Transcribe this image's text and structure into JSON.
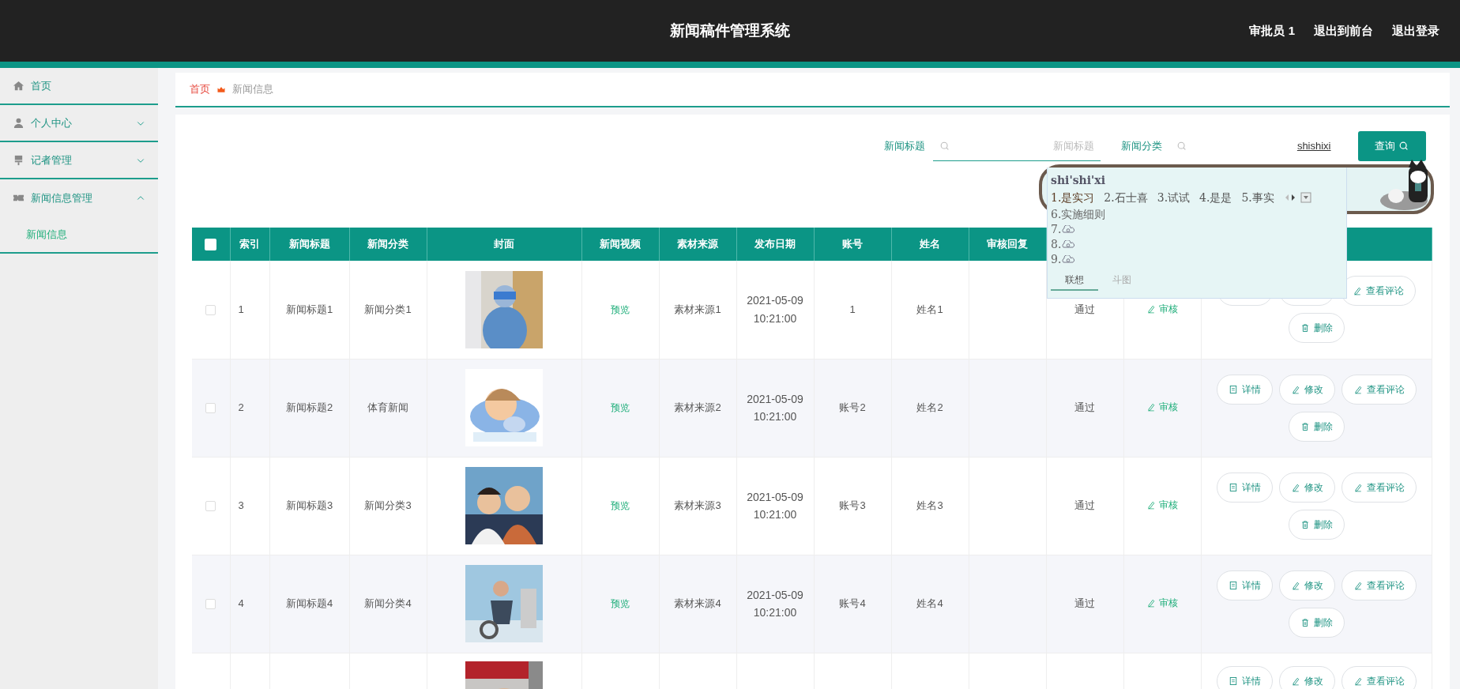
{
  "header": {
    "title": "新闻稿件管理系统",
    "links": [
      "审批员 1",
      "退出到前台",
      "退出登录"
    ]
  },
  "sidebar": {
    "items": [
      {
        "label": "首页"
      },
      {
        "label": "个人中心",
        "expanded": false
      },
      {
        "label": "记者管理",
        "expanded": false
      },
      {
        "label": "新闻信息管理",
        "expanded": true,
        "children": [
          {
            "label": "新闻信息",
            "selected": true
          }
        ]
      }
    ]
  },
  "breadcrumb": {
    "home": "首页",
    "current": "新闻信息"
  },
  "search": {
    "fields": [
      {
        "label": "新闻标题",
        "placeholder": "新闻标题"
      },
      {
        "label": "新闻分类",
        "value": "shishixi",
        "composing": true
      }
    ],
    "button": "查询"
  },
  "table": {
    "header_checkbox": {
      "checked": false
    },
    "columns": [
      "索引",
      "新闻标题",
      "新闻分类",
      "封面",
      "新闻视频",
      "素材来源",
      "发布日期",
      "账号",
      "姓名",
      "审核回复"
    ],
    "rows": [
      {
        "checked": false,
        "index": "1",
        "title": "新闻标题1",
        "category": "新闻分类1",
        "cover": {
          "kind": "picture"
        },
        "video": "预览",
        "source": "素材来源1",
        "date": "2021-05-09 10:21:00",
        "account": "1",
        "name": "姓名1",
        "status": "通过",
        "audit": "审核",
        "actions": [
          {
            "kind": "detail"
          },
          {
            "kind": "edit"
          },
          {
            "kind": "comments",
            "label": "查看评论"
          },
          {
            "kind": "delete",
            "label": "删除"
          }
        ]
      },
      {
        "checked": false,
        "index": "2",
        "title": "新闻标题2",
        "category": "体育新闻",
        "cover": {
          "kind": "picture"
        },
        "video": "预览",
        "source": "素材来源2",
        "date": "2021-05-09 10:21:00",
        "account": "账号2",
        "name": "姓名2",
        "status": "通过",
        "audit": "审核",
        "actions": [
          {
            "kind": "detail",
            "label": "详情"
          },
          {
            "kind": "edit",
            "label": "修改"
          },
          {
            "kind": "comments",
            "label": "查看评论"
          },
          {
            "kind": "delete",
            "label": "删除"
          }
        ]
      },
      {
        "checked": false,
        "index": "3",
        "title": "新闻标题3",
        "category": "新闻分类3",
        "cover": {
          "kind": "picture"
        },
        "video": "预览",
        "source": "素材来源3",
        "date": "2021-05-09 10:21:00",
        "account": "账号3",
        "name": "姓名3",
        "status": "通过",
        "audit": "审核",
        "actions": [
          {
            "kind": "detail",
            "label": "详情"
          },
          {
            "kind": "edit",
            "label": "修改"
          },
          {
            "kind": "comments",
            "label": "查看评论"
          },
          {
            "kind": "delete",
            "label": "删除"
          }
        ]
      },
      {
        "checked": false,
        "index": "4",
        "title": "新闻标题4",
        "category": "新闻分类4",
        "cover": {
          "kind": "picture"
        },
        "video": "预览",
        "source": "素材来源4",
        "date": "2021-05-09 10:21:00",
        "account": "账号4",
        "name": "姓名4",
        "status": "通过",
        "audit": "审核",
        "actions": [
          {
            "kind": "detail",
            "label": "详情"
          },
          {
            "kind": "edit",
            "label": "修改"
          },
          {
            "kind": "comments",
            "label": "查看评论"
          },
          {
            "kind": "delete",
            "label": "删除"
          }
        ]
      },
      {
        "cover": {
          "kind": "picture"
        },
        "actions": [
          {
            "kind": "detail",
            "label": "详情"
          },
          {
            "kind": "edit",
            "label": "修改"
          },
          {
            "kind": "comments",
            "label": "查看评论"
          }
        ]
      }
    ]
  },
  "ime_popup": {
    "composition": "shi'shi'xi",
    "candidates": [
      {
        "text": "1.是实习",
        "selected": true
      },
      {
        "text": "2.石士喜",
        "selected": false
      },
      {
        "text": "3.试试",
        "selected": false
      },
      {
        "text": "4.是是",
        "selected": false
      },
      {
        "text": "5.事实",
        "selected": false
      }
    ],
    "more": [
      {
        "kind": "word",
        "text": "6.实施细则"
      },
      {
        "kind": "cloud",
        "text": "7."
      },
      {
        "kind": "cloud",
        "text": "8."
      },
      {
        "kind": "cloud",
        "text": "9."
      }
    ],
    "tabs": [
      {
        "label": "联想",
        "selected": true
      },
      {
        "label": "斗图",
        "selected": false
      }
    ]
  }
}
